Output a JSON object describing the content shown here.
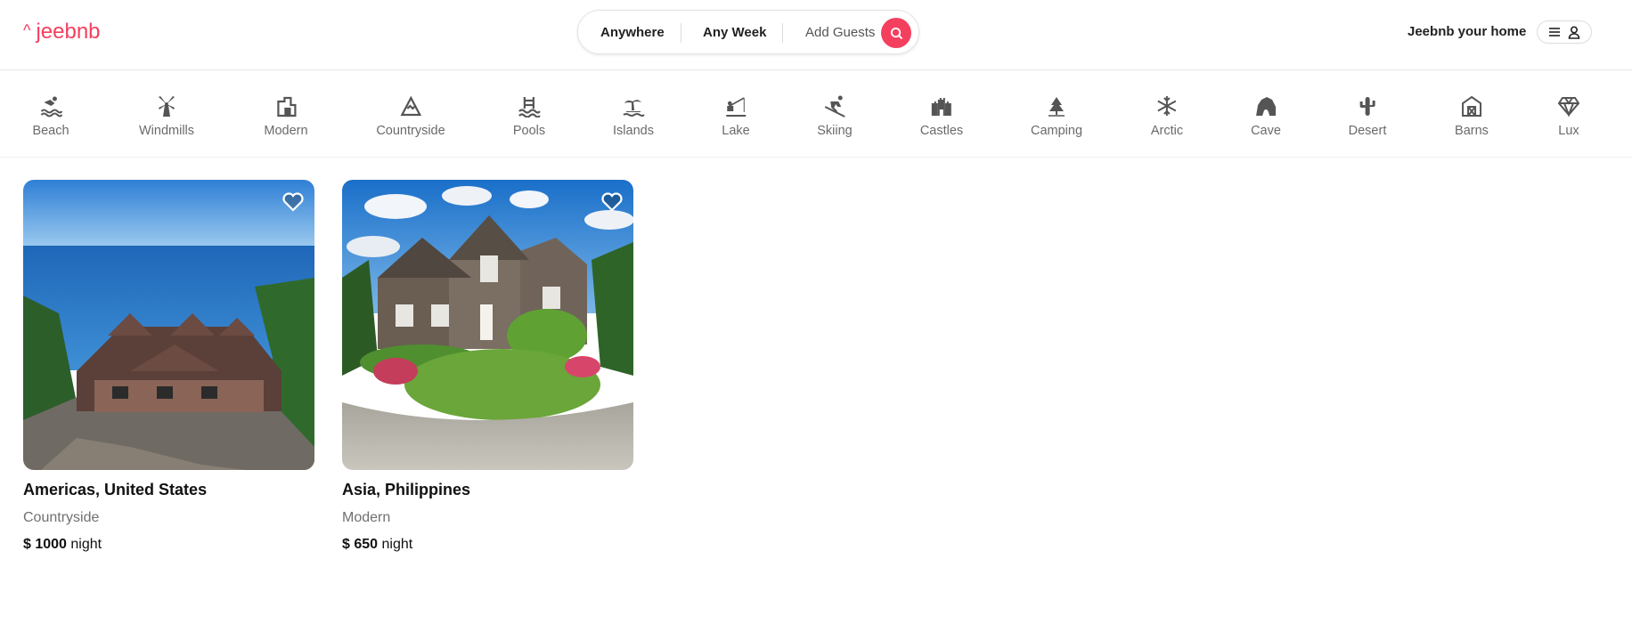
{
  "brand": {
    "mark": "^",
    "name": "jeebnb",
    "color": "#f43f5e"
  },
  "search": {
    "where": "Anywhere",
    "when": "Any Week",
    "guests": "Add Guests",
    "icon": "search-icon"
  },
  "header": {
    "host_label": "Jeebnb your home",
    "menu_icon": "hamburger-icon",
    "user_icon": "user-icon"
  },
  "categories": [
    {
      "label": "Beach",
      "icon": "beach-icon"
    },
    {
      "label": "Windmills",
      "icon": "windmill-icon"
    },
    {
      "label": "Modern",
      "icon": "modern-house-icon"
    },
    {
      "label": "Countryside",
      "icon": "mountain-icon"
    },
    {
      "label": "Pools",
      "icon": "pool-icon"
    },
    {
      "label": "Islands",
      "icon": "island-icon"
    },
    {
      "label": "Lake",
      "icon": "fishing-icon"
    },
    {
      "label": "Skiing",
      "icon": "skiing-icon"
    },
    {
      "label": "Castles",
      "icon": "castle-icon"
    },
    {
      "label": "Camping",
      "icon": "tree-icon"
    },
    {
      "label": "Arctic",
      "icon": "snowflake-icon"
    },
    {
      "label": "Cave",
      "icon": "cave-icon"
    },
    {
      "label": "Desert",
      "icon": "cactus-icon"
    },
    {
      "label": "Barns",
      "icon": "barn-icon"
    },
    {
      "label": "Lux",
      "icon": "diamond-icon"
    }
  ],
  "listings": [
    {
      "location": "Americas, United States",
      "category": "Countryside",
      "price": "$ 1000",
      "unit": "night"
    },
    {
      "location": "Asia, Philippines",
      "category": "Modern",
      "price": "$ 650",
      "unit": "night"
    }
  ]
}
